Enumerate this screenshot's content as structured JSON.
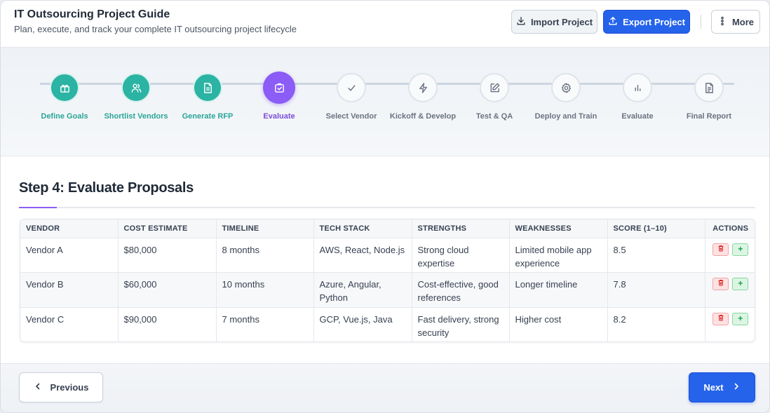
{
  "header": {
    "title": "IT Outsourcing Project Guide",
    "subtitle": "Plan, execute, and track your complete IT outsourcing project lifecycle",
    "import_label": "Import Project",
    "export_label": "Export Project",
    "more_label": "More"
  },
  "stepper": {
    "current_step": 4,
    "steps": [
      {
        "label": "Define Goals",
        "status": "done",
        "icon": "gift-icon"
      },
      {
        "label": "Shortlist Vendors",
        "status": "done",
        "icon": "users-icon"
      },
      {
        "label": "Generate RFP",
        "status": "done",
        "icon": "document-icon"
      },
      {
        "label": "Evaluate",
        "status": "active",
        "icon": "clipboard-check-icon"
      },
      {
        "label": "Select Vendor",
        "status": "todo",
        "icon": "check-icon"
      },
      {
        "label": "Kickoff & Develop",
        "status": "todo",
        "icon": "lightning-icon"
      },
      {
        "label": "Test & QA",
        "status": "todo",
        "icon": "edit-icon"
      },
      {
        "label": "Deploy and Train",
        "status": "todo",
        "icon": "gear-icon"
      },
      {
        "label": "Evaluate",
        "status": "todo",
        "icon": "bar-chart-icon"
      },
      {
        "label": "Final Report",
        "status": "todo",
        "icon": "report-icon"
      }
    ]
  },
  "main": {
    "section_title": "Step 4: Evaluate Proposals",
    "table": {
      "columns": [
        "VENDOR",
        "COST ESTIMATE",
        "TIMELINE",
        "TECH STACK",
        "STRENGTHS",
        "WEAKNESSES",
        "SCORE (1–10)",
        "ACTIONS"
      ],
      "rows": [
        {
          "vendor": "Vendor A",
          "cost": "$80,000",
          "timeline": "8 months",
          "tech": "AWS, React, Node.js",
          "strengths": "Strong cloud expertise",
          "weaknesses": "Limited mobile app experience",
          "score": "8.5"
        },
        {
          "vendor": "Vendor B",
          "cost": "$60,000",
          "timeline": "10 months",
          "tech": "Azure, Angular, Python",
          "strengths": "Cost-effective, good references",
          "weaknesses": "Longer timeline",
          "score": "7.8"
        },
        {
          "vendor": "Vendor C",
          "cost": "$90,000",
          "timeline": "7 months",
          "tech": "GCP, Vue.js, Java",
          "strengths": "Fast delivery, strong security",
          "weaknesses": "Higher cost",
          "score": "8.2"
        }
      ],
      "delete_icon": "trash-icon",
      "add_label": "+"
    }
  },
  "footer": {
    "previous_label": "Previous",
    "next_label": "Next"
  },
  "colors": {
    "accent": "#2563eb",
    "done": "#2bb3a3",
    "active": "#8b5cf6"
  }
}
